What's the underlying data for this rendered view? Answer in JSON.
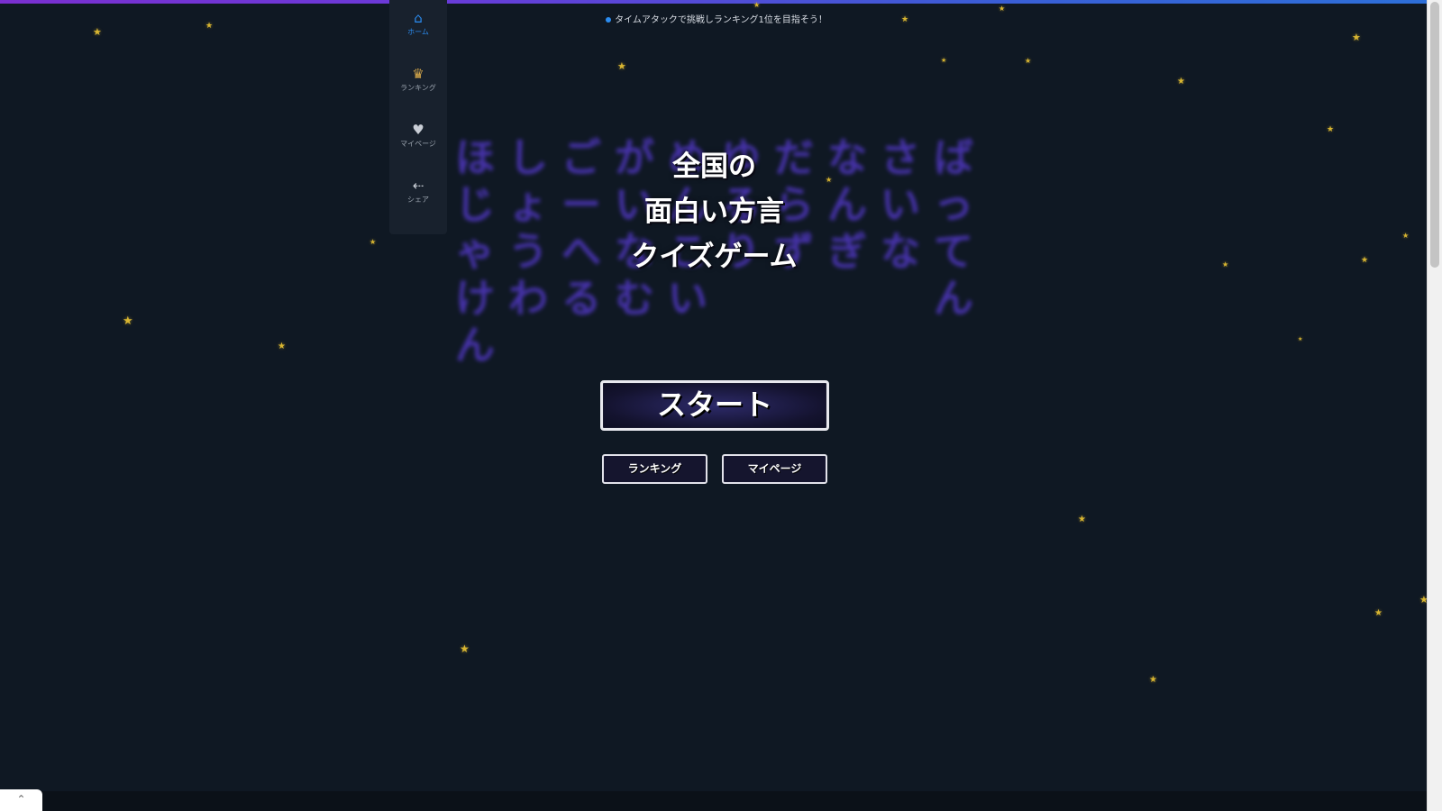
{
  "ticker": {
    "text": "タイムアタックで挑戦しランキング1位を目指そう！"
  },
  "sidebar": {
    "items": [
      {
        "label": "ホーム",
        "icon": "home-icon",
        "active": true
      },
      {
        "label": "ランキング",
        "icon": "crown-icon",
        "active": false
      },
      {
        "label": "マイページ",
        "icon": "heart-icon",
        "active": false
      },
      {
        "label": "シェア",
        "icon": "share-icon",
        "active": false
      }
    ]
  },
  "title": {
    "line1": "全国の",
    "line2": "面白い方言",
    "line3": "クイズゲーム"
  },
  "buttons": {
    "start": "スタート",
    "ranking": "ランキング",
    "mypage": "マイページ"
  },
  "background_glyphs": [
    "ほじゃけん",
    "しょうわ",
    "ごーへる",
    "がいなむ",
    "めんこい",
    "ゆるり",
    "だらず",
    "なんぎ",
    "さいな",
    "ばってん"
  ],
  "colors": {
    "background": "#0f1823",
    "accent_blue": "#2b8cf0",
    "glyph_purple": "#5a3cd8",
    "star_gold": "#d8b531",
    "stripe_start": "#7a2fd0",
    "stripe_end": "#2d6fd9"
  }
}
